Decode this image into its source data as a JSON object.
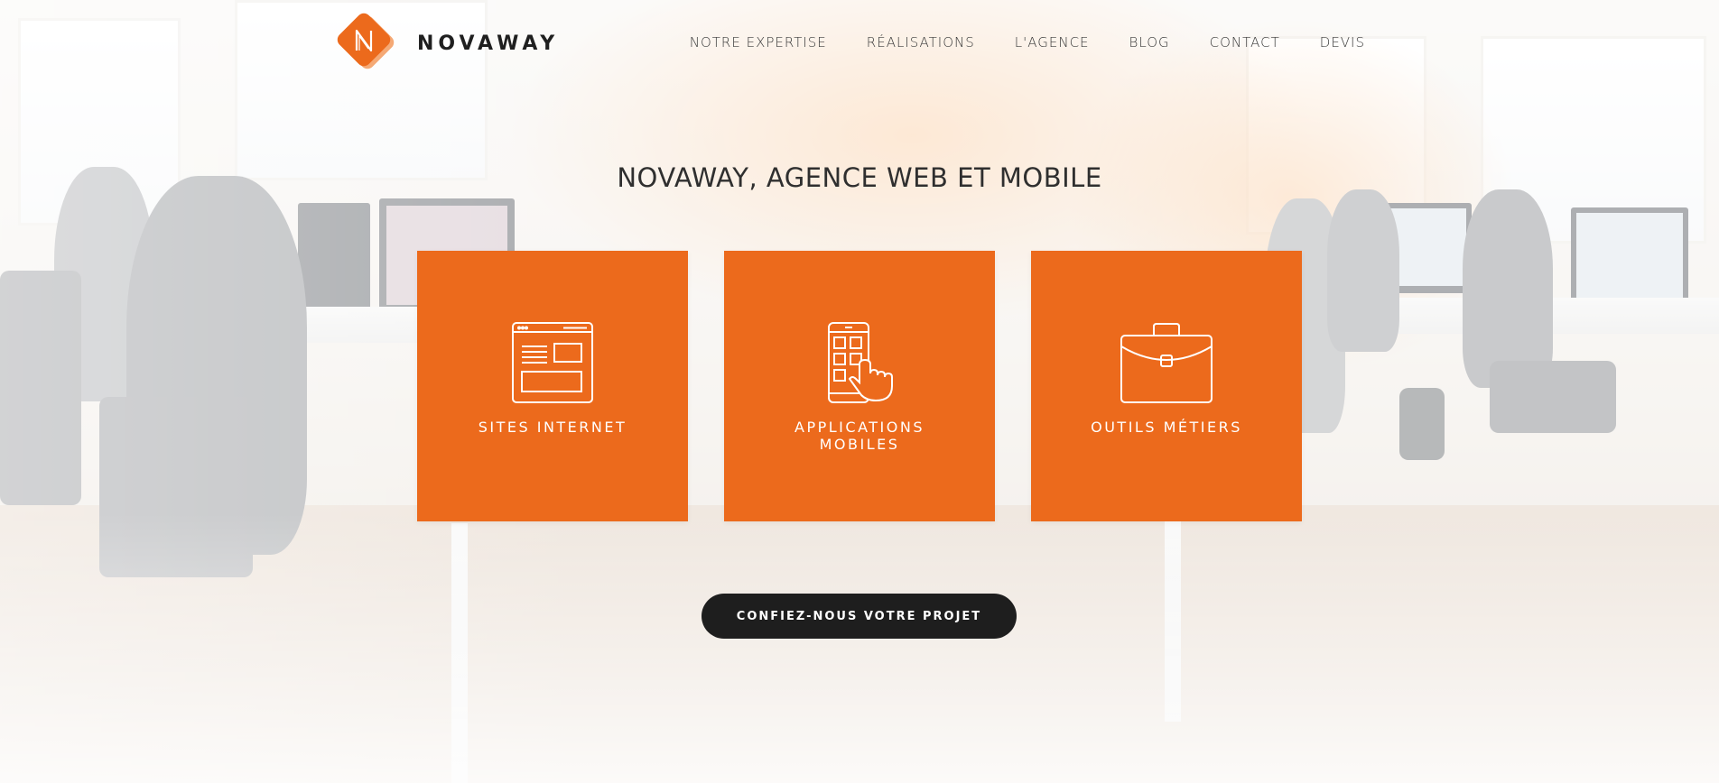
{
  "brand": {
    "name": "NOVAWAY",
    "accent_color": "#ec6a1c",
    "logo_icon": "novaway-n-logo-icon"
  },
  "nav": {
    "items": [
      {
        "label": "NOTRE EXPERTISE"
      },
      {
        "label": "RÉALISATIONS"
      },
      {
        "label": "L'AGENCE"
      },
      {
        "label": "BLOG"
      },
      {
        "label": "CONTACT"
      },
      {
        "label": "DEVIS"
      }
    ]
  },
  "hero": {
    "title": "NOVAWAY, AGENCE WEB ET MOBILE",
    "background": "office-photo"
  },
  "services": [
    {
      "label": "SITES INTERNET",
      "icon": "browser-window-icon"
    },
    {
      "label": "APPLICATIONS MOBILES",
      "icon": "smartphone-touch-icon"
    },
    {
      "label": "OUTILS MÉTIERS",
      "icon": "briefcase-icon"
    }
  ],
  "cta": {
    "label": "CONFIEZ-NOUS VOTRE PROJET",
    "color": "#1e1e1e"
  }
}
